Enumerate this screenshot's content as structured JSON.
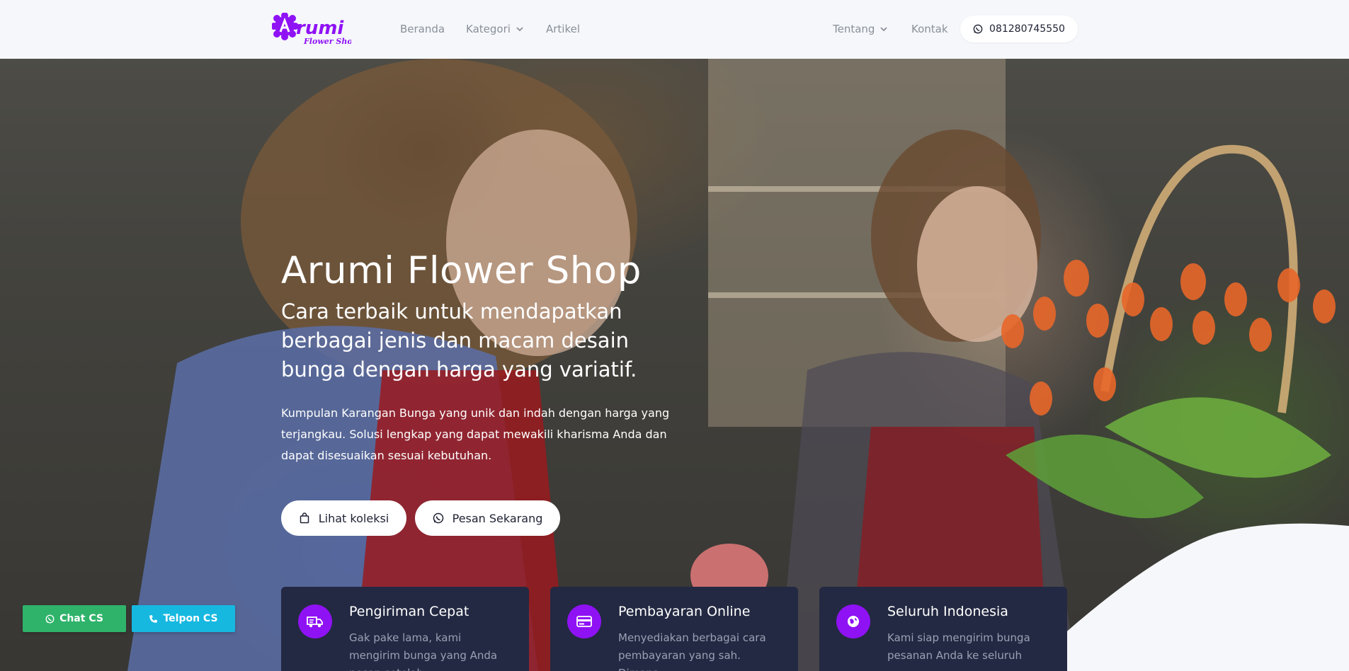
{
  "brand": {
    "logo_text": "Arumi",
    "logo_sub": "Flower Shop",
    "color": "#8f12f5"
  },
  "nav": {
    "beranda": "Beranda",
    "kategori": "Kategori",
    "artikel": "Artikel",
    "tentang": "Tentang",
    "kontak": "Kontak",
    "phone": "081280745550"
  },
  "hero": {
    "title": "Arumi Flower Shop",
    "subtitle": "Cara terbaik untuk mendapatkan berbagai jenis dan macam desain bunga dengan harga yang variatif.",
    "description": "Kumpulan Karangan Bunga yang unik dan indah dengan harga yang terjangkau. Solusi lengkap yang dapat mewakili kharisma Anda dan dapat disesuaikan sesuai kebutuhan.",
    "btn_collection": "Lihat koleksi",
    "btn_order": "Pesan Sekarang"
  },
  "features": [
    {
      "icon": "truck-icon",
      "title": "Pengiriman Cepat",
      "text": "Gak pake lama, kami mengirim bunga yang Anda pesan setelah"
    },
    {
      "icon": "credit-card-icon",
      "title": "Pembayaran Online",
      "text": "Menyediakan berbagai cara pembayaran yang sah. Dimana"
    },
    {
      "icon": "globe-icon",
      "title": "Seluruh Indonesia",
      "text": "Kami siap mengirim bunga pesanan Anda ke seluruh"
    }
  ],
  "floating": {
    "chat": "Chat CS",
    "call": "Telpon CS",
    "chat_color": "#2fb36b",
    "call_color": "#16b8e0"
  }
}
